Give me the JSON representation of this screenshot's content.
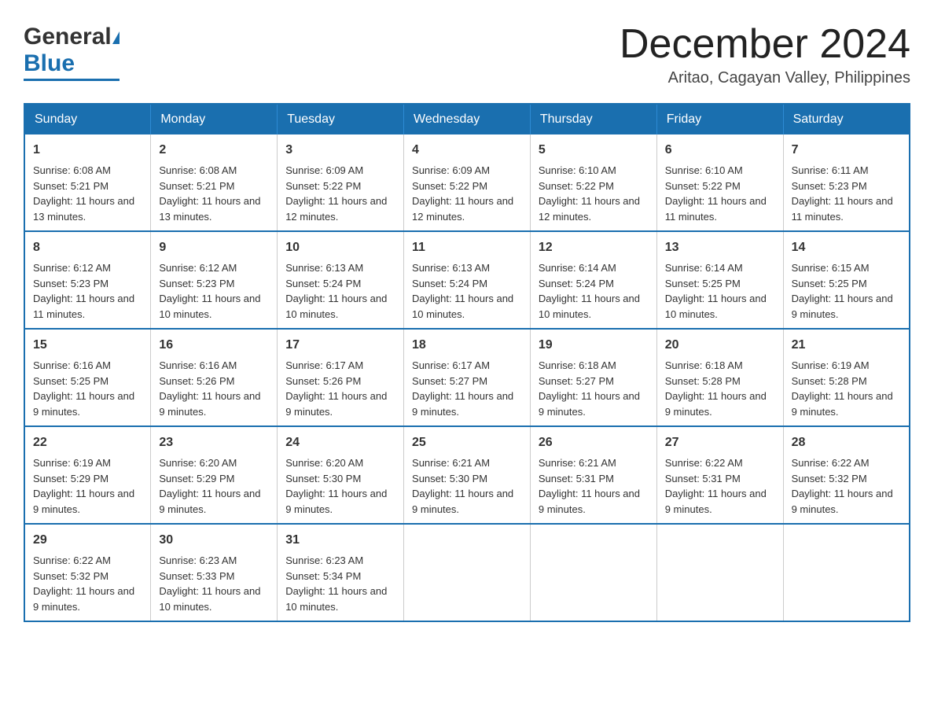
{
  "header": {
    "month_title": "December 2024",
    "location": "Aritao, Cagayan Valley, Philippines",
    "logo_general": "General",
    "logo_blue": "Blue"
  },
  "weekdays": [
    "Sunday",
    "Monday",
    "Tuesday",
    "Wednesday",
    "Thursday",
    "Friday",
    "Saturday"
  ],
  "weeks": [
    [
      {
        "day": "1",
        "sunrise": "Sunrise: 6:08 AM",
        "sunset": "Sunset: 5:21 PM",
        "daylight": "Daylight: 11 hours and 13 minutes."
      },
      {
        "day": "2",
        "sunrise": "Sunrise: 6:08 AM",
        "sunset": "Sunset: 5:21 PM",
        "daylight": "Daylight: 11 hours and 13 minutes."
      },
      {
        "day": "3",
        "sunrise": "Sunrise: 6:09 AM",
        "sunset": "Sunset: 5:22 PM",
        "daylight": "Daylight: 11 hours and 12 minutes."
      },
      {
        "day": "4",
        "sunrise": "Sunrise: 6:09 AM",
        "sunset": "Sunset: 5:22 PM",
        "daylight": "Daylight: 11 hours and 12 minutes."
      },
      {
        "day": "5",
        "sunrise": "Sunrise: 6:10 AM",
        "sunset": "Sunset: 5:22 PM",
        "daylight": "Daylight: 11 hours and 12 minutes."
      },
      {
        "day": "6",
        "sunrise": "Sunrise: 6:10 AM",
        "sunset": "Sunset: 5:22 PM",
        "daylight": "Daylight: 11 hours and 11 minutes."
      },
      {
        "day": "7",
        "sunrise": "Sunrise: 6:11 AM",
        "sunset": "Sunset: 5:23 PM",
        "daylight": "Daylight: 11 hours and 11 minutes."
      }
    ],
    [
      {
        "day": "8",
        "sunrise": "Sunrise: 6:12 AM",
        "sunset": "Sunset: 5:23 PM",
        "daylight": "Daylight: 11 hours and 11 minutes."
      },
      {
        "day": "9",
        "sunrise": "Sunrise: 6:12 AM",
        "sunset": "Sunset: 5:23 PM",
        "daylight": "Daylight: 11 hours and 10 minutes."
      },
      {
        "day": "10",
        "sunrise": "Sunrise: 6:13 AM",
        "sunset": "Sunset: 5:24 PM",
        "daylight": "Daylight: 11 hours and 10 minutes."
      },
      {
        "day": "11",
        "sunrise": "Sunrise: 6:13 AM",
        "sunset": "Sunset: 5:24 PM",
        "daylight": "Daylight: 11 hours and 10 minutes."
      },
      {
        "day": "12",
        "sunrise": "Sunrise: 6:14 AM",
        "sunset": "Sunset: 5:24 PM",
        "daylight": "Daylight: 11 hours and 10 minutes."
      },
      {
        "day": "13",
        "sunrise": "Sunrise: 6:14 AM",
        "sunset": "Sunset: 5:25 PM",
        "daylight": "Daylight: 11 hours and 10 minutes."
      },
      {
        "day": "14",
        "sunrise": "Sunrise: 6:15 AM",
        "sunset": "Sunset: 5:25 PM",
        "daylight": "Daylight: 11 hours and 9 minutes."
      }
    ],
    [
      {
        "day": "15",
        "sunrise": "Sunrise: 6:16 AM",
        "sunset": "Sunset: 5:25 PM",
        "daylight": "Daylight: 11 hours and 9 minutes."
      },
      {
        "day": "16",
        "sunrise": "Sunrise: 6:16 AM",
        "sunset": "Sunset: 5:26 PM",
        "daylight": "Daylight: 11 hours and 9 minutes."
      },
      {
        "day": "17",
        "sunrise": "Sunrise: 6:17 AM",
        "sunset": "Sunset: 5:26 PM",
        "daylight": "Daylight: 11 hours and 9 minutes."
      },
      {
        "day": "18",
        "sunrise": "Sunrise: 6:17 AM",
        "sunset": "Sunset: 5:27 PM",
        "daylight": "Daylight: 11 hours and 9 minutes."
      },
      {
        "day": "19",
        "sunrise": "Sunrise: 6:18 AM",
        "sunset": "Sunset: 5:27 PM",
        "daylight": "Daylight: 11 hours and 9 minutes."
      },
      {
        "day": "20",
        "sunrise": "Sunrise: 6:18 AM",
        "sunset": "Sunset: 5:28 PM",
        "daylight": "Daylight: 11 hours and 9 minutes."
      },
      {
        "day": "21",
        "sunrise": "Sunrise: 6:19 AM",
        "sunset": "Sunset: 5:28 PM",
        "daylight": "Daylight: 11 hours and 9 minutes."
      }
    ],
    [
      {
        "day": "22",
        "sunrise": "Sunrise: 6:19 AM",
        "sunset": "Sunset: 5:29 PM",
        "daylight": "Daylight: 11 hours and 9 minutes."
      },
      {
        "day": "23",
        "sunrise": "Sunrise: 6:20 AM",
        "sunset": "Sunset: 5:29 PM",
        "daylight": "Daylight: 11 hours and 9 minutes."
      },
      {
        "day": "24",
        "sunrise": "Sunrise: 6:20 AM",
        "sunset": "Sunset: 5:30 PM",
        "daylight": "Daylight: 11 hours and 9 minutes."
      },
      {
        "day": "25",
        "sunrise": "Sunrise: 6:21 AM",
        "sunset": "Sunset: 5:30 PM",
        "daylight": "Daylight: 11 hours and 9 minutes."
      },
      {
        "day": "26",
        "sunrise": "Sunrise: 6:21 AM",
        "sunset": "Sunset: 5:31 PM",
        "daylight": "Daylight: 11 hours and 9 minutes."
      },
      {
        "day": "27",
        "sunrise": "Sunrise: 6:22 AM",
        "sunset": "Sunset: 5:31 PM",
        "daylight": "Daylight: 11 hours and 9 minutes."
      },
      {
        "day": "28",
        "sunrise": "Sunrise: 6:22 AM",
        "sunset": "Sunset: 5:32 PM",
        "daylight": "Daylight: 11 hours and 9 minutes."
      }
    ],
    [
      {
        "day": "29",
        "sunrise": "Sunrise: 6:22 AM",
        "sunset": "Sunset: 5:32 PM",
        "daylight": "Daylight: 11 hours and 9 minutes."
      },
      {
        "day": "30",
        "sunrise": "Sunrise: 6:23 AM",
        "sunset": "Sunset: 5:33 PM",
        "daylight": "Daylight: 11 hours and 10 minutes."
      },
      {
        "day": "31",
        "sunrise": "Sunrise: 6:23 AM",
        "sunset": "Sunset: 5:34 PM",
        "daylight": "Daylight: 11 hours and 10 minutes."
      },
      null,
      null,
      null,
      null
    ]
  ]
}
